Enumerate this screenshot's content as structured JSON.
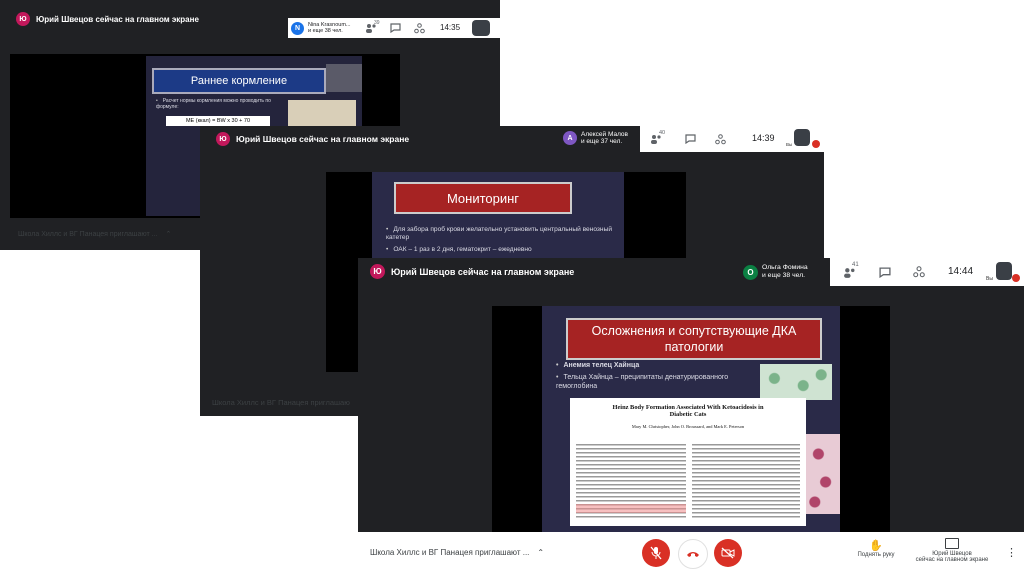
{
  "windows": [
    {
      "presenter_initial": "Ю",
      "presenter_text": "Юрий Швецов сейчас на главном экране",
      "participant_initial": "N",
      "participant_name": "Nina Krasnoum...",
      "participant_more": "и еще 38 чел.",
      "count": "39",
      "time": "14:35",
      "slide_title": "Раннее кормление",
      "bullets": [
        "Расчет нормы кормления можно проводить по формуле:"
      ],
      "formula": "МЕ (ккал) = BW x 30 + 70",
      "footer": "Школа Хиллс и ВГ Панацея приглашают ..."
    },
    {
      "presenter_initial": "Ю",
      "presenter_text": "Юрий Швецов сейчас на главном экране",
      "participant_initial": "А",
      "participant_name": "Алексей Малов",
      "participant_more": "и еще 37 чел.",
      "count": "40",
      "time": "14:39",
      "self_label": "Вы",
      "slide_title": "Мониторинг",
      "bullets": [
        "Для забора проб крови желательно установить центральный венозный катетер",
        "ОАК – 1 раз в 2 дня, гематокрит – ежедневно"
      ],
      "footer": "Школа Хиллс и ВГ Панацея приглашаю"
    },
    {
      "presenter_initial": "Ю",
      "presenter_text": "Юрий Швецов сейчас на главном экране",
      "participant_initial": "О",
      "participant_name": "Ольга Фомина",
      "participant_more": "и еще 38 чел.",
      "count": "41",
      "time": "14:44",
      "self_label": "Вы",
      "slide_title": "Осложнения и сопутствующие ДКА патологии",
      "bullets": [
        "Анемия телец Хайнца",
        "Тельца Хайнца – преципитаты денатурированного гемоглобина"
      ],
      "paper_title": "Heinz Body Formation Associated With Ketoacidosis in Diabetic Cats",
      "paper_authors": "Mary M. Christopher, John O. Broussard, and Mark E. Peterson",
      "footer": "Школа Хиллс и ВГ Панацея приглашают ...",
      "raise_hand": "Поднять руку",
      "presenting_line1": "Юрий Швецов",
      "presenting_line2": "сейчас на главном экране"
    }
  ],
  "colors": {
    "topbar": "#202124",
    "end_call": "#d93025",
    "accent_pink": "#c2185b",
    "slide_bg": "#24243c"
  }
}
